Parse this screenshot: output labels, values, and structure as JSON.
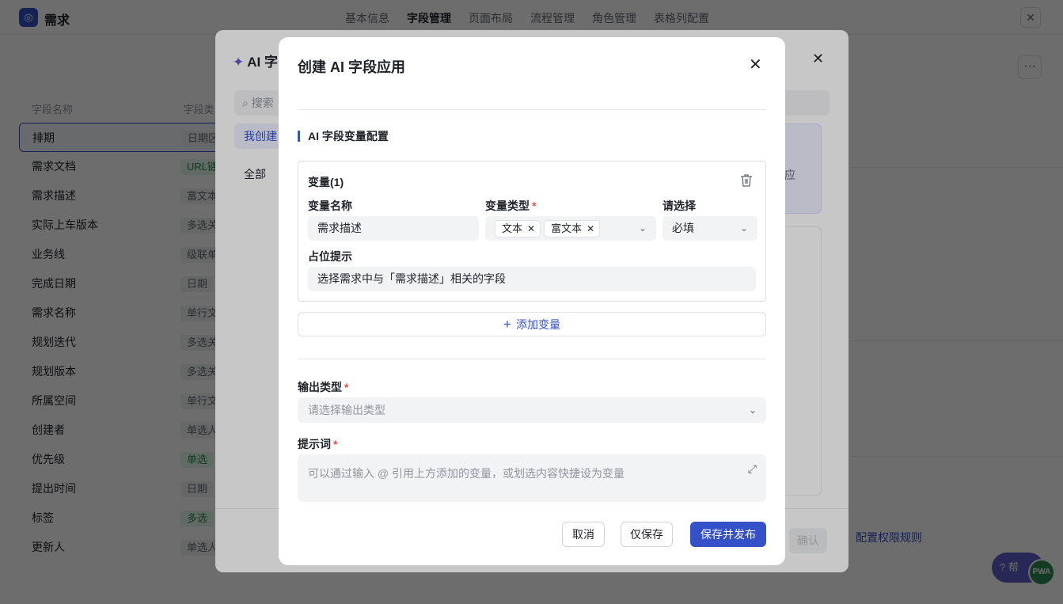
{
  "app": {
    "logo_glyph": "◎",
    "title": "需求",
    "close_glyph": "✕"
  },
  "top_tabs": [
    "基本信息",
    "字段管理",
    "页面布局",
    "流程管理",
    "角色管理",
    "表格列配置"
  ],
  "field_list": {
    "header_name": "字段名称",
    "header_type": "字段类",
    "rows": [
      {
        "name": "排期",
        "type": "日期区"
      },
      {
        "name": "需求文档",
        "type": "URL链"
      },
      {
        "name": "需求描述",
        "type": "富文本"
      },
      {
        "name": "实际上车版本",
        "type": "多选关"
      },
      {
        "name": "业务线",
        "type": "级联单"
      },
      {
        "name": "完成日期",
        "type": "日期"
      },
      {
        "name": "需求名称",
        "type": "单行文"
      },
      {
        "name": "规划迭代",
        "type": "多选关"
      },
      {
        "name": "规划版本",
        "type": "多选关"
      },
      {
        "name": "所属空间",
        "type": "单行文"
      },
      {
        "name": "创建者",
        "type": "单选人"
      },
      {
        "name": "优先级",
        "type": "单选"
      },
      {
        "name": "提出时间",
        "type": "日期"
      },
      {
        "name": "标签",
        "type": "多选"
      },
      {
        "name": "更新人",
        "type": "单选人"
      }
    ]
  },
  "right_bg": {
    "more_glyph": "···",
    "permission_link": "配置权限规则"
  },
  "help": {
    "label": "帮",
    "pwa": "PWA"
  },
  "ai_modal": {
    "title": "AI 字",
    "search_placeholder": "搜索",
    "sidebar": [
      "我创建",
      "全部"
    ],
    "card_text": "应",
    "confirm": "确认"
  },
  "dialog": {
    "title": "创建 AI 字段应用",
    "section_title": "AI 字段变量配置",
    "variable": {
      "title": "变量(1)",
      "name_label": "变量名称",
      "name_value": "需求描述",
      "type_label": "变量类型",
      "type_tags": [
        "文本",
        "富文本"
      ],
      "select_label": "请选择",
      "select_value": "必填",
      "placeholder_label": "占位提示",
      "placeholder_value": "选择需求中与「需求描述」相关的字段"
    },
    "add_variable": "添加变量",
    "output_type_label": "输出类型",
    "output_type_placeholder": "请选择输出类型",
    "prompt_label": "提示词",
    "prompt_placeholder": "可以通过输入 @ 引用上方添加的变量，或划选内容快捷设为变量",
    "buttons": {
      "cancel": "取消",
      "save_only": "仅保存",
      "save_publish": "保存并发布"
    }
  }
}
